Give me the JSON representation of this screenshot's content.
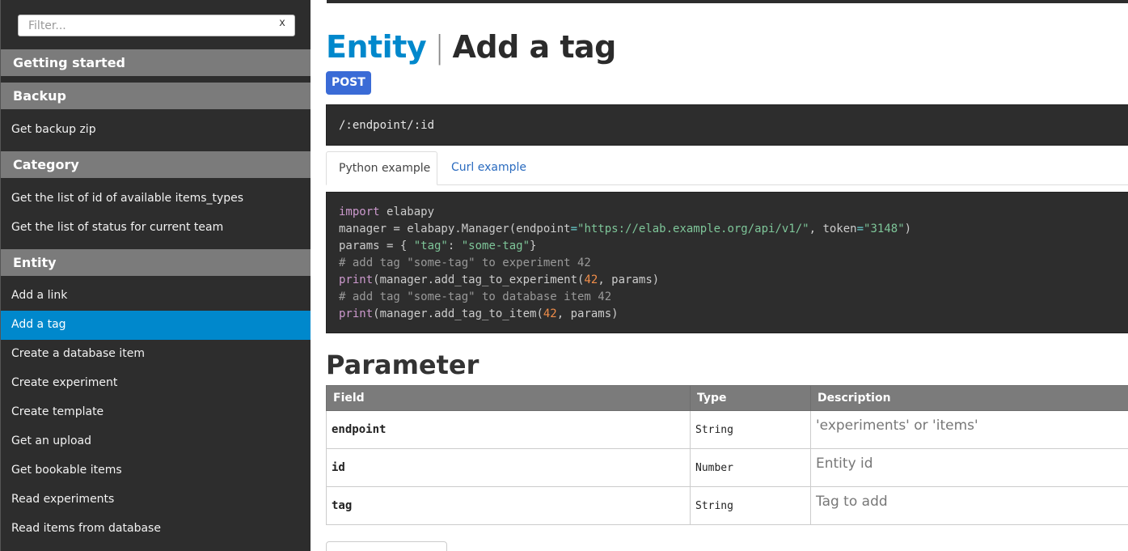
{
  "sidebar": {
    "filter_placeholder": "Filter...",
    "filter_clear": "x",
    "groups": [
      {
        "label": "Getting started"
      },
      {
        "label": "Backup"
      },
      {
        "label": "Category"
      },
      {
        "label": "Entity"
      }
    ],
    "items": [
      {
        "label": "Get backup zip"
      },
      {
        "label": "Get the list of id of available items_types"
      },
      {
        "label": "Get the list of status for current team"
      },
      {
        "label": "Add a link"
      },
      {
        "label": "Add a tag"
      },
      {
        "label": "Create a database item"
      },
      {
        "label": "Create experiment"
      },
      {
        "label": "Create template"
      },
      {
        "label": "Get an upload"
      },
      {
        "label": "Get bookable items"
      },
      {
        "label": "Read experiments"
      },
      {
        "label": "Read items from database"
      }
    ],
    "active_item": "Add a tag",
    "active_color": "#0088cc"
  },
  "main": {
    "title_group": "Entity",
    "title_sep": "|",
    "title_name": "Add a tag",
    "method": "POST",
    "endpoint": "/:endpoint/:id",
    "tabs": [
      {
        "label": "Python example",
        "active": true
      },
      {
        "label": "Curl example",
        "active": false
      }
    ],
    "code_lines": [
      "import elabapy",
      "manager = elabapy.Manager(endpoint=\"https://elab.example.org/api/v1/\", token=\"3148\")",
      "params = { \"tag\": \"some-tag\"}",
      "# add tag \"some-tag\" to experiment 42",
      "print(manager.add_tag_to_experiment(42, params)",
      "# add tag \"some-tag\" to database item 42",
      "print(manager.add_tag_to_item(42, params)"
    ],
    "code_tokens": {
      "kw_import": "import",
      "mod": "elabapy",
      "manager_assign": "manager = elabapy.Manager(endpoint",
      "eq": "=",
      "url": "\"https://elab.example.org/api/v1/\"",
      "token_arg": ", token",
      "token_val": "\"3148\"",
      "close_paren": ")",
      "params_open": "params = { ",
      "tag_key": "\"tag\"",
      "colon": ": ",
      "tag_val": "\"some-tag\"",
      "params_close": "}",
      "comment1": "# add tag \"some-tag\" to experiment 42",
      "print": "print",
      "call1": "(manager.add_tag_to_experiment(",
      "num42": "42",
      "call_tail": ", params)",
      "comment2": "# add tag \"some-tag\" to database item 42",
      "call2": "(manager.add_tag_to_item("
    },
    "parameter_title": "Parameter",
    "table": {
      "headers": [
        "Field",
        "Type",
        "Description"
      ],
      "rows": [
        {
          "field": "endpoint",
          "type": "String",
          "description": "'experiments' or 'items'"
        },
        {
          "field": "id",
          "type": "Number",
          "description": "Entity id"
        },
        {
          "field": "tag",
          "type": "String",
          "description": "Tag to add"
        }
      ]
    }
  }
}
